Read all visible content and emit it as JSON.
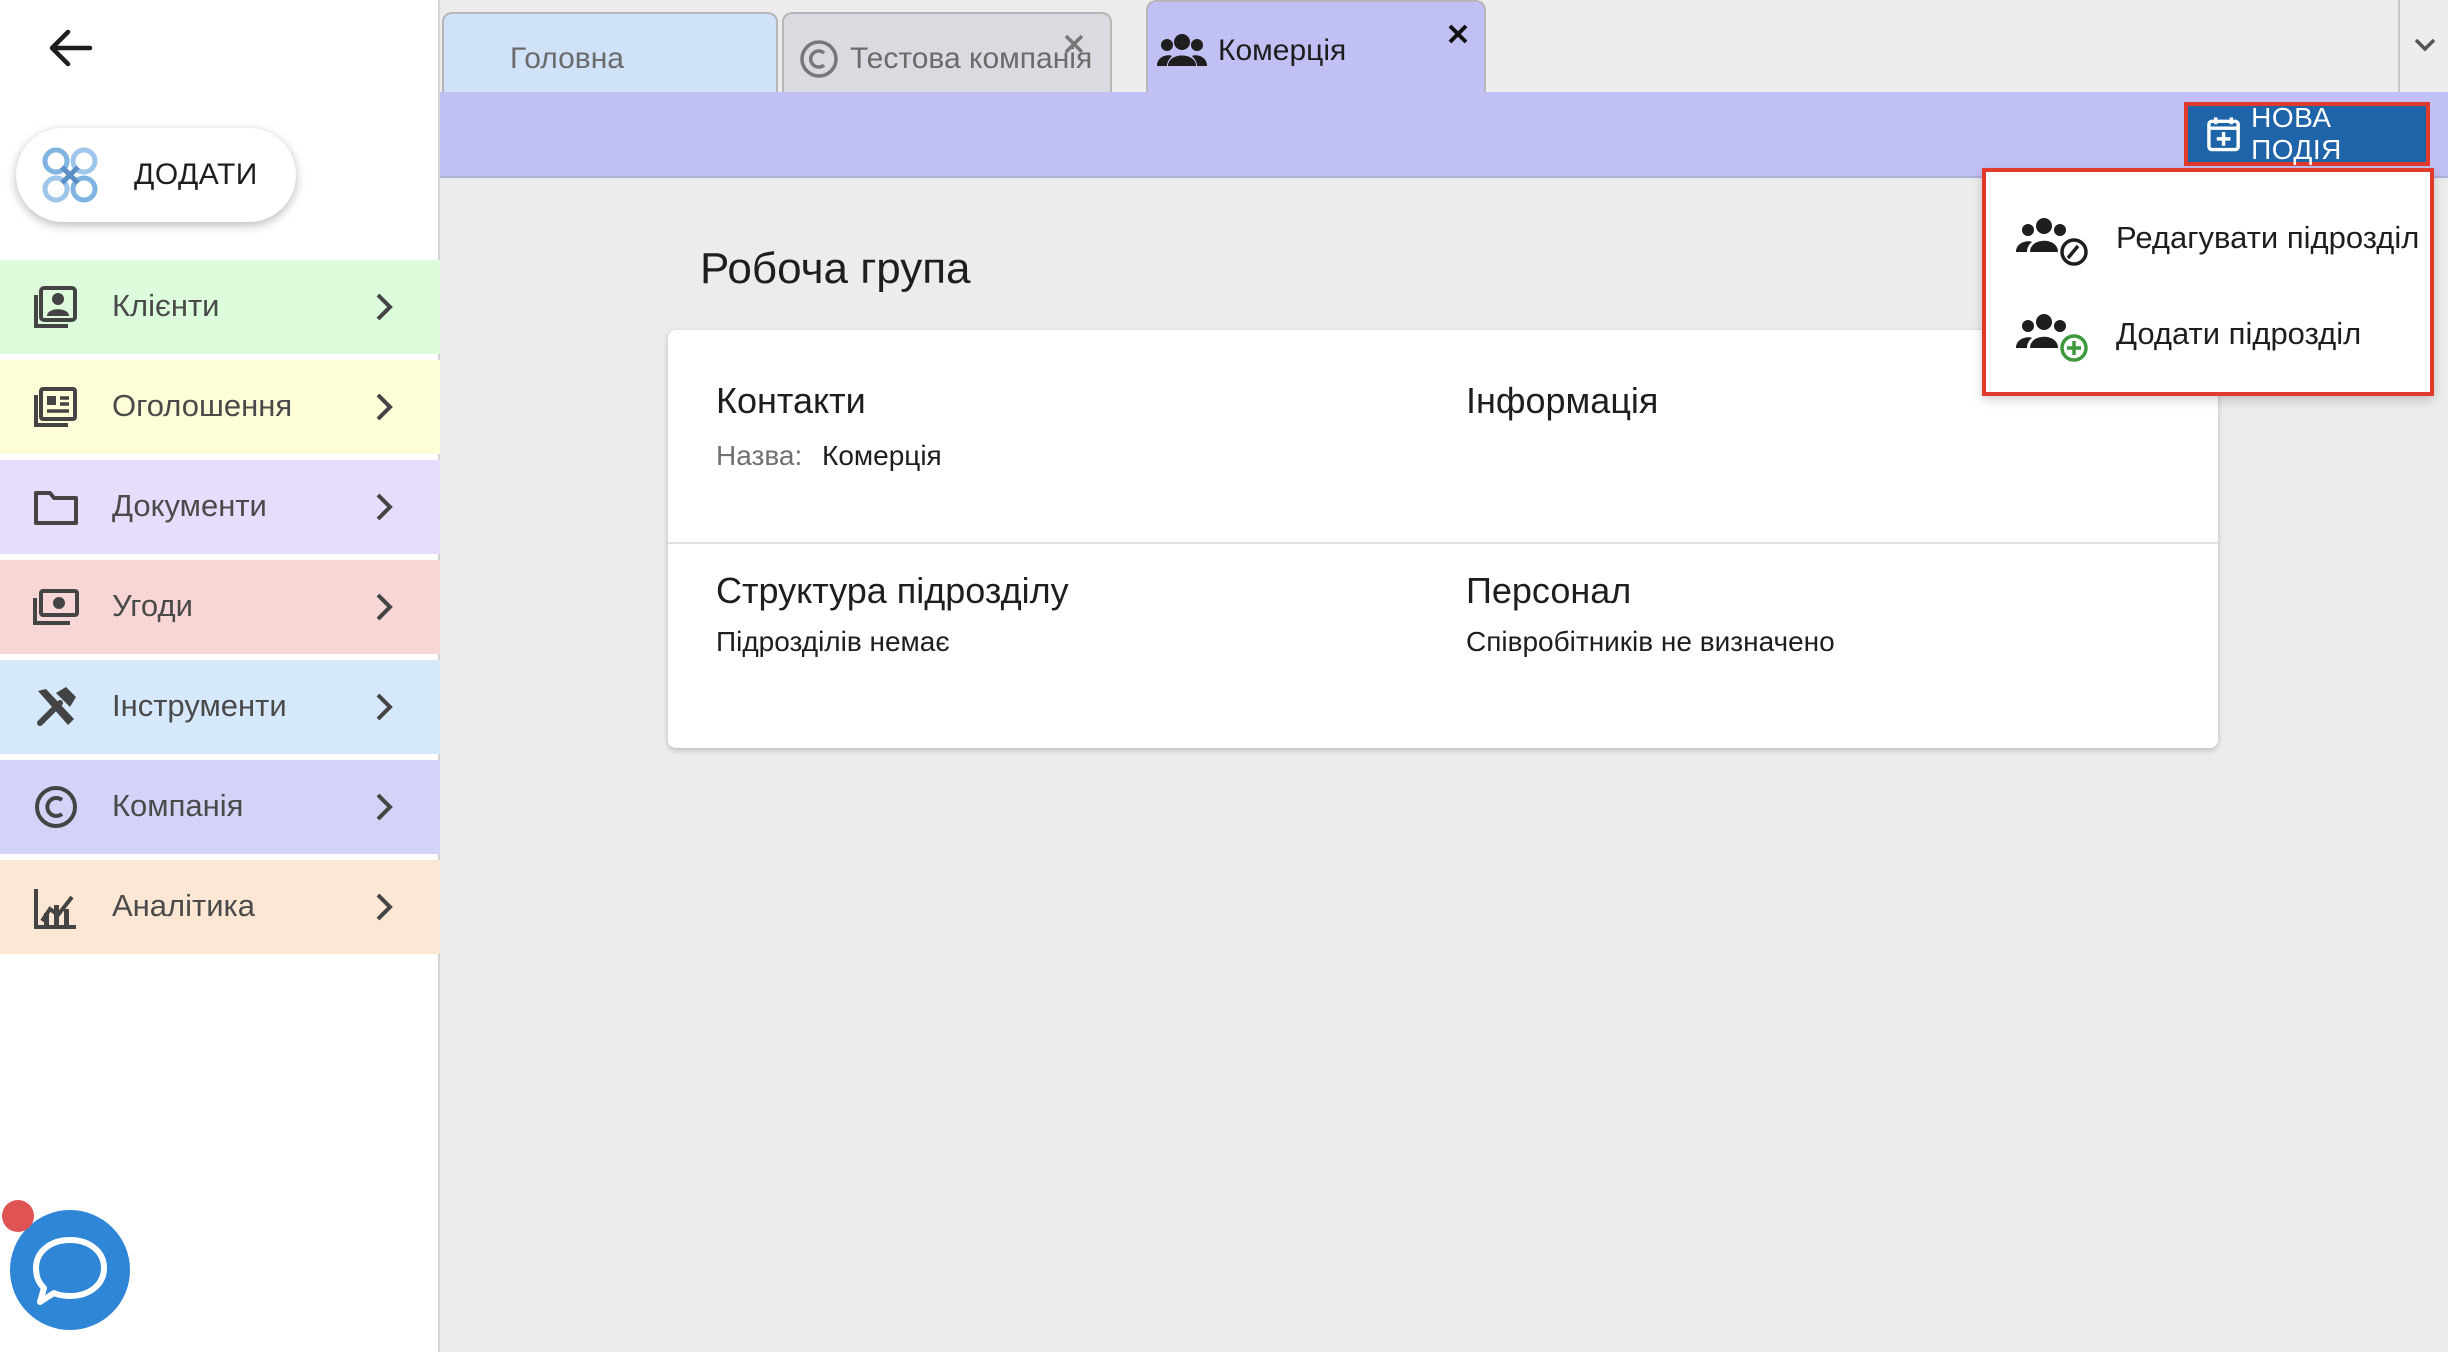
{
  "sidebar": {
    "add_label": "ДОДАТИ",
    "items": [
      {
        "label": "Клієнти",
        "icon": "contacts-icon",
        "bg": "#dcfcdc"
      },
      {
        "label": "Оголошення",
        "icon": "newspaper-icon",
        "bg": "#fdfdd7"
      },
      {
        "label": "Документи",
        "icon": "folder-icon",
        "bg": "#e8dcfc"
      },
      {
        "label": "Угоди",
        "icon": "money-icon",
        "bg": "#f8d6d6"
      },
      {
        "label": "Інструменти",
        "icon": "tools-icon",
        "bg": "#d6e8fb"
      },
      {
        "label": "Компанія",
        "icon": "copyright-icon",
        "bg": "#d3d3f8"
      },
      {
        "label": "Аналітика",
        "icon": "analytics-icon",
        "bg": "#fce6d4"
      }
    ]
  },
  "tabs": [
    {
      "label": "Головна"
    },
    {
      "label": "Тестова компанія"
    },
    {
      "label": "Комерція",
      "active": true
    }
  ],
  "toolbar": {
    "new_event_label": "НОВА ПОДІЯ"
  },
  "menu": {
    "items": [
      {
        "label": "Редагувати підрозділ",
        "icon": "group-edit-icon"
      },
      {
        "label": "Додати підрозділ",
        "icon": "group-add-icon"
      }
    ]
  },
  "main": {
    "title": "Робоча група",
    "contacts": {
      "heading": "Контакти",
      "name_label": "Назва:",
      "name_value": "Комерція"
    },
    "info": {
      "heading": "Інформація"
    },
    "structure": {
      "heading": "Структура підрозділу",
      "text": "Підрозділів немає"
    },
    "personnel": {
      "heading": "Персонал",
      "text": "Співробітників не визначено"
    }
  },
  "colors": {
    "accent": "#1f63a8",
    "toolbar": "#c0c0f4",
    "highlight": "#e03a2c"
  }
}
